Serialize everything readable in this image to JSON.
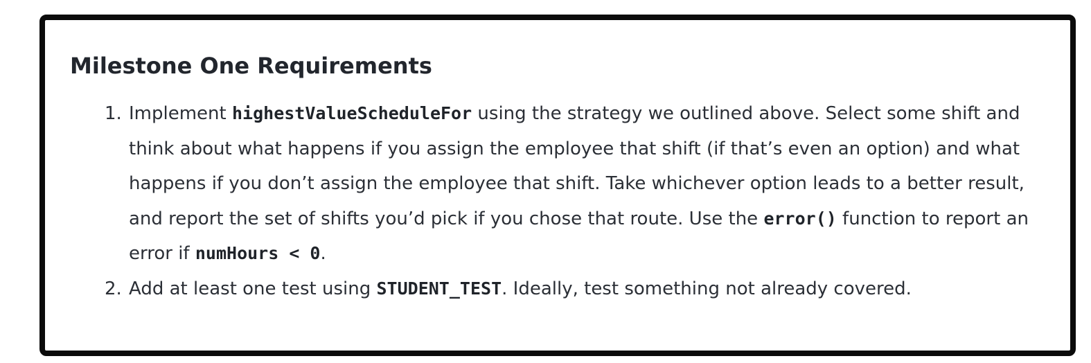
{
  "section": {
    "title": "Milestone One Requirements"
  },
  "requirements": [
    {
      "number": "1.",
      "segments": [
        "Implement ",
        "highestValueScheduleFor",
        " using the strategy we outlined above. Select some shift and think about what happens if you assign the employee that shift (if that’s even an option) and what happens if you don’t assign the employee that shift. Take whichever option leads to a better result, and report the set of shifts you’d pick if you chose that route. Use the ",
        "error()",
        " function to report an error if ",
        "numHours < 0",
        "."
      ]
    },
    {
      "number": "2.",
      "segments": [
        "Add at least one test using ",
        "STUDENT_TEST",
        ". Ideally, test something not already covered."
      ]
    }
  ]
}
